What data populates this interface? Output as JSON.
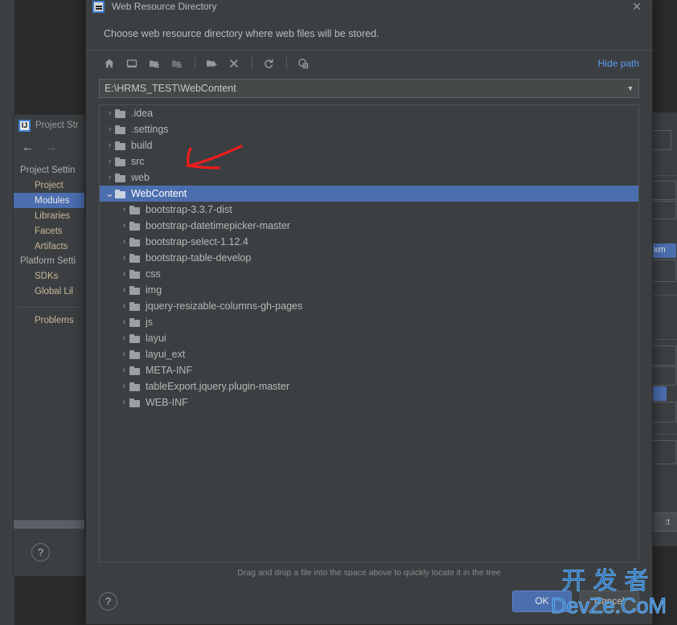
{
  "background": {
    "project_structure": {
      "title": "Project Str",
      "icon": "intellij-idea-icon",
      "nav": {
        "back": "←",
        "forward": "→"
      },
      "groups": [
        {
          "label": "Project Settin",
          "items": [
            {
              "label": "Project",
              "selected": false
            },
            {
              "label": "Modules",
              "selected": true
            },
            {
              "label": "Libraries",
              "selected": false
            },
            {
              "label": "Facets",
              "selected": false
            },
            {
              "label": "Artifacts",
              "selected": false
            }
          ]
        },
        {
          "label": "Platform Setti",
          "items": [
            {
              "label": "SDKs",
              "selected": false
            },
            {
              "label": "Global Lil",
              "selected": false
            }
          ]
        }
      ],
      "problems_label": "Problems",
      "help_label": "?"
    },
    "right_panel": {
      "chevron": "‹",
      "blue_row_label": "o.xm",
      "button_label": ":t"
    }
  },
  "dialog": {
    "title": "Web Resource Directory",
    "icon": "module-settings-icon",
    "close_label": "✕",
    "subtitle": "Choose web resource directory where web files will be stored.",
    "toolbar": {
      "buttons": [
        {
          "name": "home-icon",
          "tooltip": "Home"
        },
        {
          "name": "desktop-icon",
          "tooltip": "Desktop"
        },
        {
          "name": "project-folder-icon",
          "tooltip": "Project Directory"
        },
        {
          "name": "module-folder-icon",
          "tooltip": "Module Directory"
        },
        {
          "name": "new-folder-icon",
          "tooltip": "New Folder"
        },
        {
          "name": "delete-icon",
          "tooltip": "Delete"
        },
        {
          "name": "refresh-icon",
          "tooltip": "Refresh"
        },
        {
          "name": "show-hidden-icon",
          "tooltip": "Show Hidden Files"
        }
      ],
      "hide_path_label": "Hide path"
    },
    "path": {
      "value": "E:\\HRMS_TEST\\WebContent",
      "placeholder": "",
      "dropdown_icon": "chevron-down-icon"
    },
    "tree": [
      {
        "label": ".idea",
        "depth": 0,
        "expanded": false,
        "selected": false
      },
      {
        "label": ".settings",
        "depth": 0,
        "expanded": false,
        "selected": false
      },
      {
        "label": "build",
        "depth": 0,
        "expanded": false,
        "selected": false
      },
      {
        "label": "src",
        "depth": 0,
        "expanded": false,
        "selected": false
      },
      {
        "label": "web",
        "depth": 0,
        "expanded": false,
        "selected": false
      },
      {
        "label": "WebContent",
        "depth": 0,
        "expanded": true,
        "selected": true
      },
      {
        "label": "bootstrap-3.3.7-dist",
        "depth": 1,
        "expanded": false,
        "selected": false
      },
      {
        "label": "bootstrap-datetimepicker-master",
        "depth": 1,
        "expanded": false,
        "selected": false
      },
      {
        "label": "bootstrap-select-1.12.4",
        "depth": 1,
        "expanded": false,
        "selected": false
      },
      {
        "label": "bootstrap-table-develop",
        "depth": 1,
        "expanded": false,
        "selected": false
      },
      {
        "label": "css",
        "depth": 1,
        "expanded": false,
        "selected": false
      },
      {
        "label": "img",
        "depth": 1,
        "expanded": false,
        "selected": false
      },
      {
        "label": "jquery-resizable-columns-gh-pages",
        "depth": 1,
        "expanded": false,
        "selected": false
      },
      {
        "label": "js",
        "depth": 1,
        "expanded": false,
        "selected": false
      },
      {
        "label": "layui",
        "depth": 1,
        "expanded": false,
        "selected": false
      },
      {
        "label": "layui_ext",
        "depth": 1,
        "expanded": false,
        "selected": false
      },
      {
        "label": "META-INF",
        "depth": 1,
        "expanded": false,
        "selected": false
      },
      {
        "label": "tableExport.jquery.plugin-master",
        "depth": 1,
        "expanded": false,
        "selected": false
      },
      {
        "label": "WEB-INF",
        "depth": 1,
        "expanded": false,
        "selected": false
      }
    ],
    "hint": "Drag and drop a file into the space above to quickly locate it in the tree",
    "footer": {
      "help_label": "?",
      "ok_label": "OK",
      "cancel_label": "Cancel"
    }
  },
  "annotation": {
    "type": "arrow",
    "color": "#ee1c1c",
    "points_to": "WebContent"
  },
  "watermark": {
    "line1": "开发者",
    "line2": "DevZe.CoM"
  },
  "colors": {
    "dialog_bg": "#3c3f41",
    "selection_blue": "#4b6eaf",
    "link_blue": "#589df6",
    "text": "#b7b7b7",
    "annotation_red": "#ee1c1c"
  }
}
